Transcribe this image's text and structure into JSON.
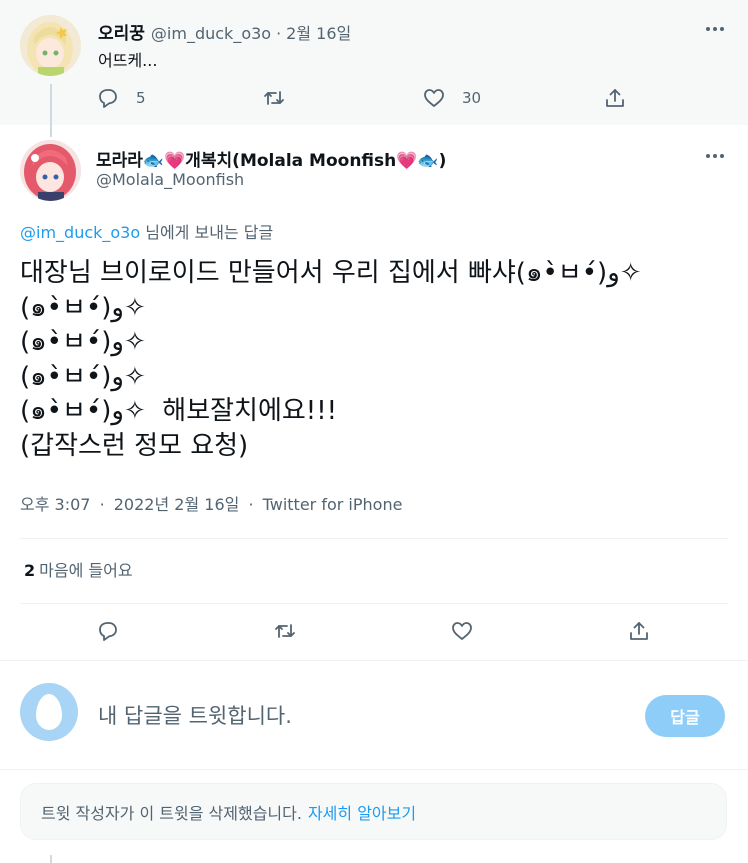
{
  "parent_tweet": {
    "display_name": "오리꿍",
    "handle": "@im_duck_o3o",
    "separator": "·",
    "date": "2월 16일",
    "text": "어뜨케...",
    "reply_count": "5",
    "like_count": "30",
    "icons": [
      "reply-icon",
      "retweet-icon",
      "like-icon",
      "share-icon",
      "more-icon"
    ]
  },
  "main_tweet": {
    "display_name": "모라라🐟💗개복치(Molala Moonfish💗🐟)",
    "handle": "@Molala_Moonfish",
    "replying_to_handle": "@im_duck_o3o",
    "replying_to_suffix": " 님에게 보내는 답글",
    "body": "대장님 브이로이드 만들어서 우리 집에서 빠샤(๑•̀ㅂ•́)و✧\n(๑•̀ㅂ•́)و✧\n(๑•̀ㅂ•́)و✧\n(๑•̀ㅂ•́)و✧\n(๑•̀ㅂ•́)و✧  해보잘치에요!!!\n(갑작스런 정모 요청)",
    "time": "오후 3:07",
    "separator": "·",
    "date": "2022년 2월 16일",
    "source": "Twitter for iPhone",
    "like_count": "2",
    "like_label": "마음에 들어요"
  },
  "reply_box": {
    "placeholder": "내 답글을 트윗합니다.",
    "button_label": "답글"
  },
  "deleted_notice": {
    "text": "트윗 작성자가 이 트윗을 삭제했습니다.",
    "link": "자세히 알아보기"
  },
  "colors": {
    "accent": "#1d9bf0",
    "secondary_text": "#536471",
    "reply_button_disabled": "#8ecdf8",
    "parent_background": "#f7f9f9"
  }
}
